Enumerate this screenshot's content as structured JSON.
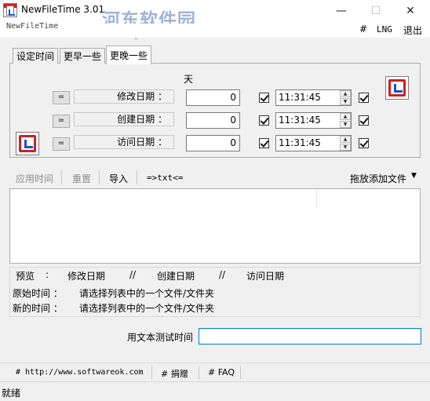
{
  "window": {
    "title": "NewFileTime 3.01",
    "subtitle": "NewFileTime",
    "watermark": "河东软件园",
    "watermark_url": "www.pc0359.cn",
    "controls": {
      "minimize": "—",
      "maximize": "☐",
      "close": "✕"
    }
  },
  "menu": {
    "hash": "#",
    "lng": "LNG",
    "exit": "退出"
  },
  "tabs": [
    "设定时间",
    "更早一些",
    "更晚一些"
  ],
  "panel": {
    "days_header": "天",
    "rows": [
      {
        "eq": "=",
        "label": "修改日期 ：",
        "days": "0",
        "time": "11:31:45"
      },
      {
        "eq": "=",
        "label": "创建日期 ：",
        "days": "0",
        "time": "11:31:45"
      },
      {
        "eq": "=",
        "label": "访问日期 ：",
        "days": "0",
        "time": "11:31:45"
      }
    ]
  },
  "toolbar": {
    "apply": "应用时间",
    "reset": "重置",
    "import": "导入",
    "txt": "=>txt<=",
    "drag_add": "拖放添加文件",
    "drag_arrow": "▼"
  },
  "preview": {
    "label": "预览",
    "colon": ":",
    "modified": "修改日期",
    "sep": "//",
    "created": "创建日期",
    "accessed": "访问日期",
    "original_label": "原始时间 ：",
    "original_value": "请选择列表中的一个文件/文件夹",
    "new_label": "新的时间 ：",
    "new_value": "请选择列表中的一个文件/文件夹"
  },
  "test": {
    "label": "用文本测试时间",
    "value": ""
  },
  "footer": {
    "url": "# http://www.softwareok.com",
    "donate": "# 捐赠",
    "faq": "# FAQ"
  },
  "status": "就绪",
  "colors": {
    "accent": "#0078d7",
    "icon_red": "#cc2020",
    "icon_blue": "#1c4fd1"
  }
}
